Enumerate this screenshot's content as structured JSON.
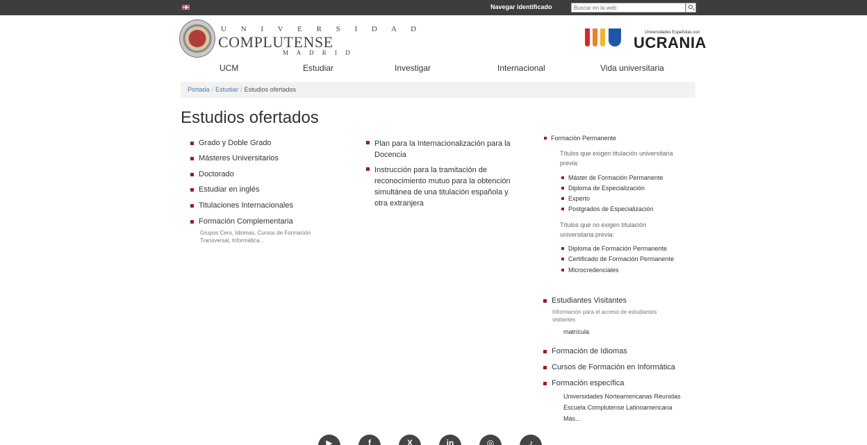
{
  "topbar": {
    "language_flag": "uk-flag-icon",
    "navegar_identificado": "Navegar identificado",
    "search_placeholder": "Buscar en la web"
  },
  "header": {
    "brand_line1": "U N I V E R S I D A D",
    "brand_line2": "COMPLUTENSE",
    "brand_line3": "M A D R I D",
    "ucrania_small": "Universidades Españolas con",
    "ucrania_big": "UCRANIA",
    "ucrania_colors": [
      "#d7262b",
      "#e9822e",
      "#f2b531",
      "#1f57a7"
    ]
  },
  "nav": {
    "items": [
      "UCM",
      "Estudiar",
      "Investigar",
      "Internacional",
      "Vida universitaria"
    ]
  },
  "breadcrumb": {
    "items": [
      "Portada",
      "Estudiar",
      "Estudios ofertados"
    ]
  },
  "page_title": "Estudios ofertados",
  "col1": {
    "items": [
      "Grado y Doble Grado",
      "Másteres Universitarios",
      "Doctorado",
      "Estudiar en inglés",
      "Titulaciones Internacionales",
      "Formación Complementaria"
    ],
    "fc_note_line1": "Grupos Cero, Idiomas, Cursos de Formación",
    "fc_note_line2": "Transversal, Informática..."
  },
  "col2": {
    "item1_line1": "Plan para la Internacionalización para la",
    "item1_line2": "Docencia",
    "item2_line1": "Instrucción para la tramitación de",
    "item2_line2": "reconocimiento mutuo para la obtención",
    "item2_line3": "simultánea de una titulación española y",
    "item2_line4": "otra extranjera"
  },
  "col3": {
    "fp_title": "Formación Permanente",
    "group1_line1": "Títulos que exigen titulación universitaria",
    "group1_line2": "previa:",
    "group1_items": [
      "Máster de Formación Permanente",
      "Diploma de Especialización",
      "Experto",
      "Postgrados de Especialización"
    ],
    "group2_line1": "Títulos que no exigen titulación",
    "group2_line2": "universitaria previa:",
    "group2_items": [
      "Diploma de Formación Permanente",
      "Certificado de Formación Permanente",
      "Microcredenciales"
    ],
    "ev_title": "Estudiantes Visitantes",
    "ev_note_line1": "Información para el acceso de estudiantes",
    "ev_note_line2": "visitantes",
    "ev_link": "matrícula",
    "idiomas": "Formación de Idiomas",
    "informatica": "Cursos de Formación en Informática",
    "especifica": "Formación específica",
    "esp_link1": "Universidades Norteamericanas Reunidas",
    "esp_link2": "Escuela Complutense Latinoamericana",
    "esp_more": "Más..."
  },
  "footer": {
    "social": [
      "youtube-icon",
      "facebook-icon",
      "x-icon",
      "linkedin-icon",
      "instagram-icon",
      "tiktok-icon"
    ],
    "social_glyphs": [
      "▶",
      "f",
      "X",
      "in",
      "◎",
      "♪"
    ]
  }
}
